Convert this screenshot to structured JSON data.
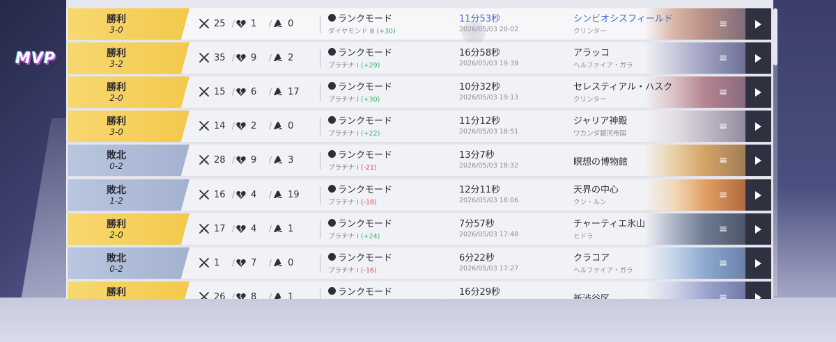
{
  "mvp_label": "MVP",
  "matches": [
    {
      "result": "勝利",
      "score": "3-0",
      "outcome": "win",
      "kills": "25",
      "deaths": "1",
      "assists": "0",
      "mode": "ランクモード",
      "rank": "ダイヤモンド Ⅲ",
      "delta": "(+30)",
      "delta_sign": "pos",
      "duration": "11分53秒",
      "date": "2026/05/03 20:02",
      "map": "シンビオシスフィールド",
      "region": "クリンター",
      "highlight": true
    },
    {
      "result": "勝利",
      "score": "3-2",
      "outcome": "win",
      "kills": "35",
      "deaths": "9",
      "assists": "2",
      "mode": "ランクモード",
      "rank": "プラチナ Ⅰ",
      "delta": "(+29)",
      "delta_sign": "pos",
      "duration": "16分58秒",
      "date": "2026/05/03 19:39",
      "map": "アラッコ",
      "region": "ヘルファイア・ガラ",
      "highlight": false
    },
    {
      "result": "勝利",
      "score": "2-0",
      "outcome": "win",
      "kills": "15",
      "deaths": "6",
      "assists": "17",
      "mode": "ランクモード",
      "rank": "プラチナ Ⅰ",
      "delta": "(+30)",
      "delta_sign": "pos",
      "duration": "10分32秒",
      "date": "2026/05/03 19:13",
      "map": "セレスティアル・ハスク",
      "region": "クリンター",
      "highlight": false
    },
    {
      "result": "勝利",
      "score": "3-0",
      "outcome": "win",
      "kills": "14",
      "deaths": "2",
      "assists": "0",
      "mode": "ランクモード",
      "rank": "プラチナ Ⅰ",
      "delta": "(+22)",
      "delta_sign": "pos",
      "duration": "11分12秒",
      "date": "2026/05/03 18:51",
      "map": "ジャリア神殿",
      "region": "ワカンダ銀河帝国",
      "highlight": false
    },
    {
      "result": "敗北",
      "score": "0-2",
      "outcome": "loss",
      "kills": "28",
      "deaths": "9",
      "assists": "3",
      "mode": "ランクモード",
      "rank": "プラチナ Ⅰ",
      "delta": "(-21)",
      "delta_sign": "neg",
      "duration": "13分7秒",
      "date": "2026/05/03 18:32",
      "map": "瞑想の博物館",
      "region": "",
      "highlight": false
    },
    {
      "result": "敗北",
      "score": "1-2",
      "outcome": "loss",
      "kills": "16",
      "deaths": "4",
      "assists": "19",
      "mode": "ランクモード",
      "rank": "プラチナ Ⅰ",
      "delta": "(-18)",
      "delta_sign": "neg",
      "duration": "12分11秒",
      "date": "2026/05/03 18:06",
      "map": "天界の中心",
      "region": "クン・ルン",
      "highlight": false
    },
    {
      "result": "勝利",
      "score": "2-0",
      "outcome": "win",
      "kills": "17",
      "deaths": "4",
      "assists": "1",
      "mode": "ランクモード",
      "rank": "プラチナ Ⅰ",
      "delta": "(+24)",
      "delta_sign": "pos",
      "duration": "7分57秒",
      "date": "2026/05/03 17:48",
      "map": "チャーティエ氷山",
      "region": "ヒドラ",
      "highlight": false
    },
    {
      "result": "敗北",
      "score": "0-2",
      "outcome": "loss",
      "kills": "1",
      "deaths": "7",
      "assists": "0",
      "mode": "ランクモード",
      "rank": "プラチナ Ⅰ",
      "delta": "(-16)",
      "delta_sign": "neg",
      "duration": "6分22秒",
      "date": "2026/05/03 17:27",
      "map": "クラコア",
      "region": "ヘルファイア・ガラ",
      "highlight": false
    },
    {
      "result": "勝利",
      "score": "",
      "outcome": "win",
      "kills": "26",
      "deaths": "8",
      "assists": "1",
      "mode": "ランクモード",
      "rank": "",
      "delta": "",
      "delta_sign": "pos",
      "duration": "16分29秒",
      "date": "",
      "map": "新渋谷区",
      "region": "",
      "highlight": false
    }
  ],
  "colors": {
    "win": "#f3c94c",
    "loss": "#a3b2cf",
    "accent": "#4a6bc4",
    "positive": "#3fae6b",
    "negative": "#d24a4a"
  },
  "icons": {
    "kills": "crossed-swords-icon",
    "deaths": "broken-heart-icon",
    "assists": "helping-hand-icon",
    "mode": "playstation-icon",
    "menu": "menu-icon",
    "play": "play-icon"
  }
}
